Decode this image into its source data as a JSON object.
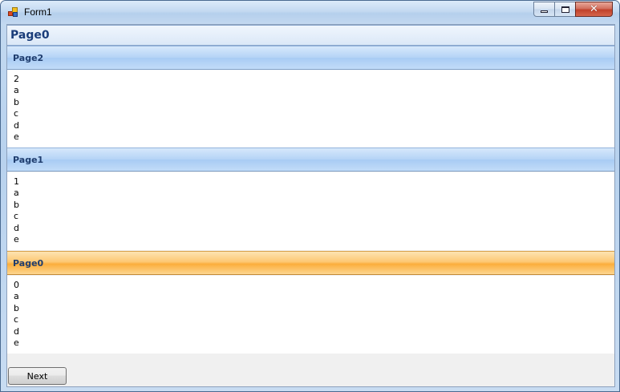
{
  "window": {
    "title": "Form1"
  },
  "header": {
    "title": "Page0"
  },
  "pages": [
    {
      "label": "Page2",
      "lines": [
        "2",
        "a",
        "b",
        "c",
        "d",
        "e"
      ],
      "active": false
    },
    {
      "label": "Page1",
      "lines": [
        "1",
        "a",
        "b",
        "c",
        "d",
        "e"
      ],
      "active": false
    },
    {
      "label": "Page0",
      "lines": [
        "0",
        "a",
        "b",
        "c",
        "d",
        "e"
      ],
      "active": true
    }
  ],
  "footer": {
    "next_label": "Next"
  },
  "colors": {
    "active_header": "#fbae3c",
    "inactive_header": "#b4d3f6",
    "title_text": "#1a3d7a"
  }
}
